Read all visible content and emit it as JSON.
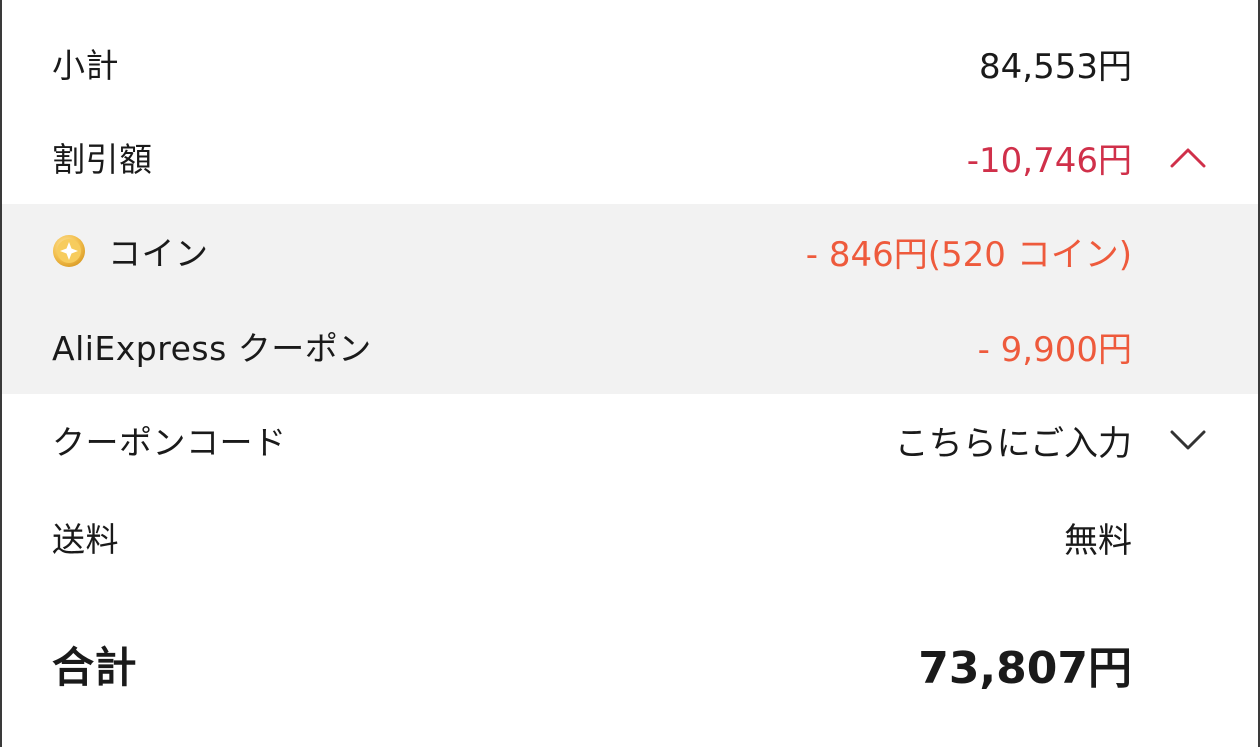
{
  "summary": {
    "subtotal": {
      "label": "小計",
      "value": "84,553円"
    },
    "discount": {
      "label": "割引額",
      "value": "-10,746円",
      "icon": "chevron-up-icon",
      "color": "#d0304a"
    },
    "coins": {
      "label": "コイン",
      "value": "- 846円(520 コイン)",
      "icon": "coin-icon",
      "color": "#ee5a3c"
    },
    "aliexpress_coupon": {
      "label": "AliExpress クーポン",
      "value": "- 9,900円",
      "color": "#ee5a3c"
    },
    "coupon_code": {
      "label": "クーポンコード",
      "value": "こちらにご入力",
      "icon": "chevron-down-icon"
    },
    "shipping": {
      "label": "送料",
      "value": "無料"
    },
    "total": {
      "label": "合計",
      "value": "73,807円"
    }
  }
}
